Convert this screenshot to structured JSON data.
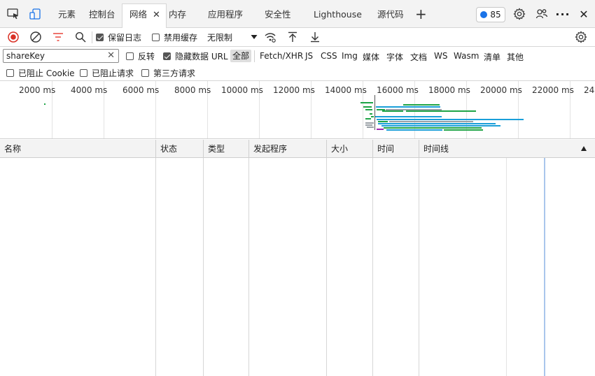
{
  "tabbar": {
    "tabs": [
      {
        "label": "元素"
      },
      {
        "label": "控制台"
      },
      {
        "label": "网络",
        "active": true
      },
      {
        "label": "内存"
      },
      {
        "label": "应用程序"
      },
      {
        "label": "安全性"
      },
      {
        "label": "Lighthouse"
      },
      {
        "label": "源代码"
      }
    ],
    "close_glyph": "✕",
    "add_glyph": "+",
    "issues_count": "85",
    "more_glyph": "···",
    "close_devtools_glyph": "✕"
  },
  "toolbar": {
    "preserve_log": {
      "label": "保留日志",
      "checked": true
    },
    "disable_cache": {
      "label": "禁用缓存",
      "checked": false
    },
    "throttling": {
      "value": "无限制"
    }
  },
  "filter": {
    "value": "shareKey",
    "clear_glyph": "✕",
    "invert": {
      "label": "反转",
      "checked": false
    },
    "hide_data_urls": {
      "label": "隐藏数据 URL",
      "checked": true
    },
    "types": [
      "全部",
      "Fetch/XHR",
      "JS",
      "CSS",
      "Img",
      "媒体",
      "字体",
      "文档",
      "WS",
      "Wasm",
      "清单",
      "其他"
    ],
    "selected_type": "全部",
    "blocked_cookies": {
      "label": "已阻止 Cookie",
      "checked": false
    },
    "blocked_requests": {
      "label": "已阻止请求",
      "checked": false
    },
    "third_party": {
      "label": "第三方请求",
      "checked": false
    }
  },
  "overview": {
    "ticks": [
      "2000 ms",
      "4000 ms",
      "6000 ms",
      "8000 ms",
      "10000 ms",
      "12000 ms",
      "14000 ms",
      "16000 ms",
      "18000 ms",
      "20000 ms",
      "22000 ms",
      "24"
    ]
  },
  "table": {
    "columns": [
      "名称",
      "状态",
      "类型",
      "发起程序",
      "大小",
      "时间",
      "时间线"
    ],
    "rows": []
  },
  "colors": {
    "record_red": "#d93025",
    "filter_red": "#e8453c",
    "green": "#1ea446",
    "blue": "#1a9fd9",
    "gray": "#9aa0a6",
    "purple": "#9c27b0",
    "issues_blue": "#1a73e8"
  },
  "icons": [
    "inspect-icon",
    "device-icon",
    "settings-gear-icon",
    "connect-icon",
    "more-icon",
    "close-icon",
    "record-icon",
    "clear-icon",
    "filter-icon",
    "search-icon",
    "wifi-settings-icon",
    "upload-icon",
    "download-icon",
    "network-settings-icon",
    "sort-ascending-icon"
  ]
}
